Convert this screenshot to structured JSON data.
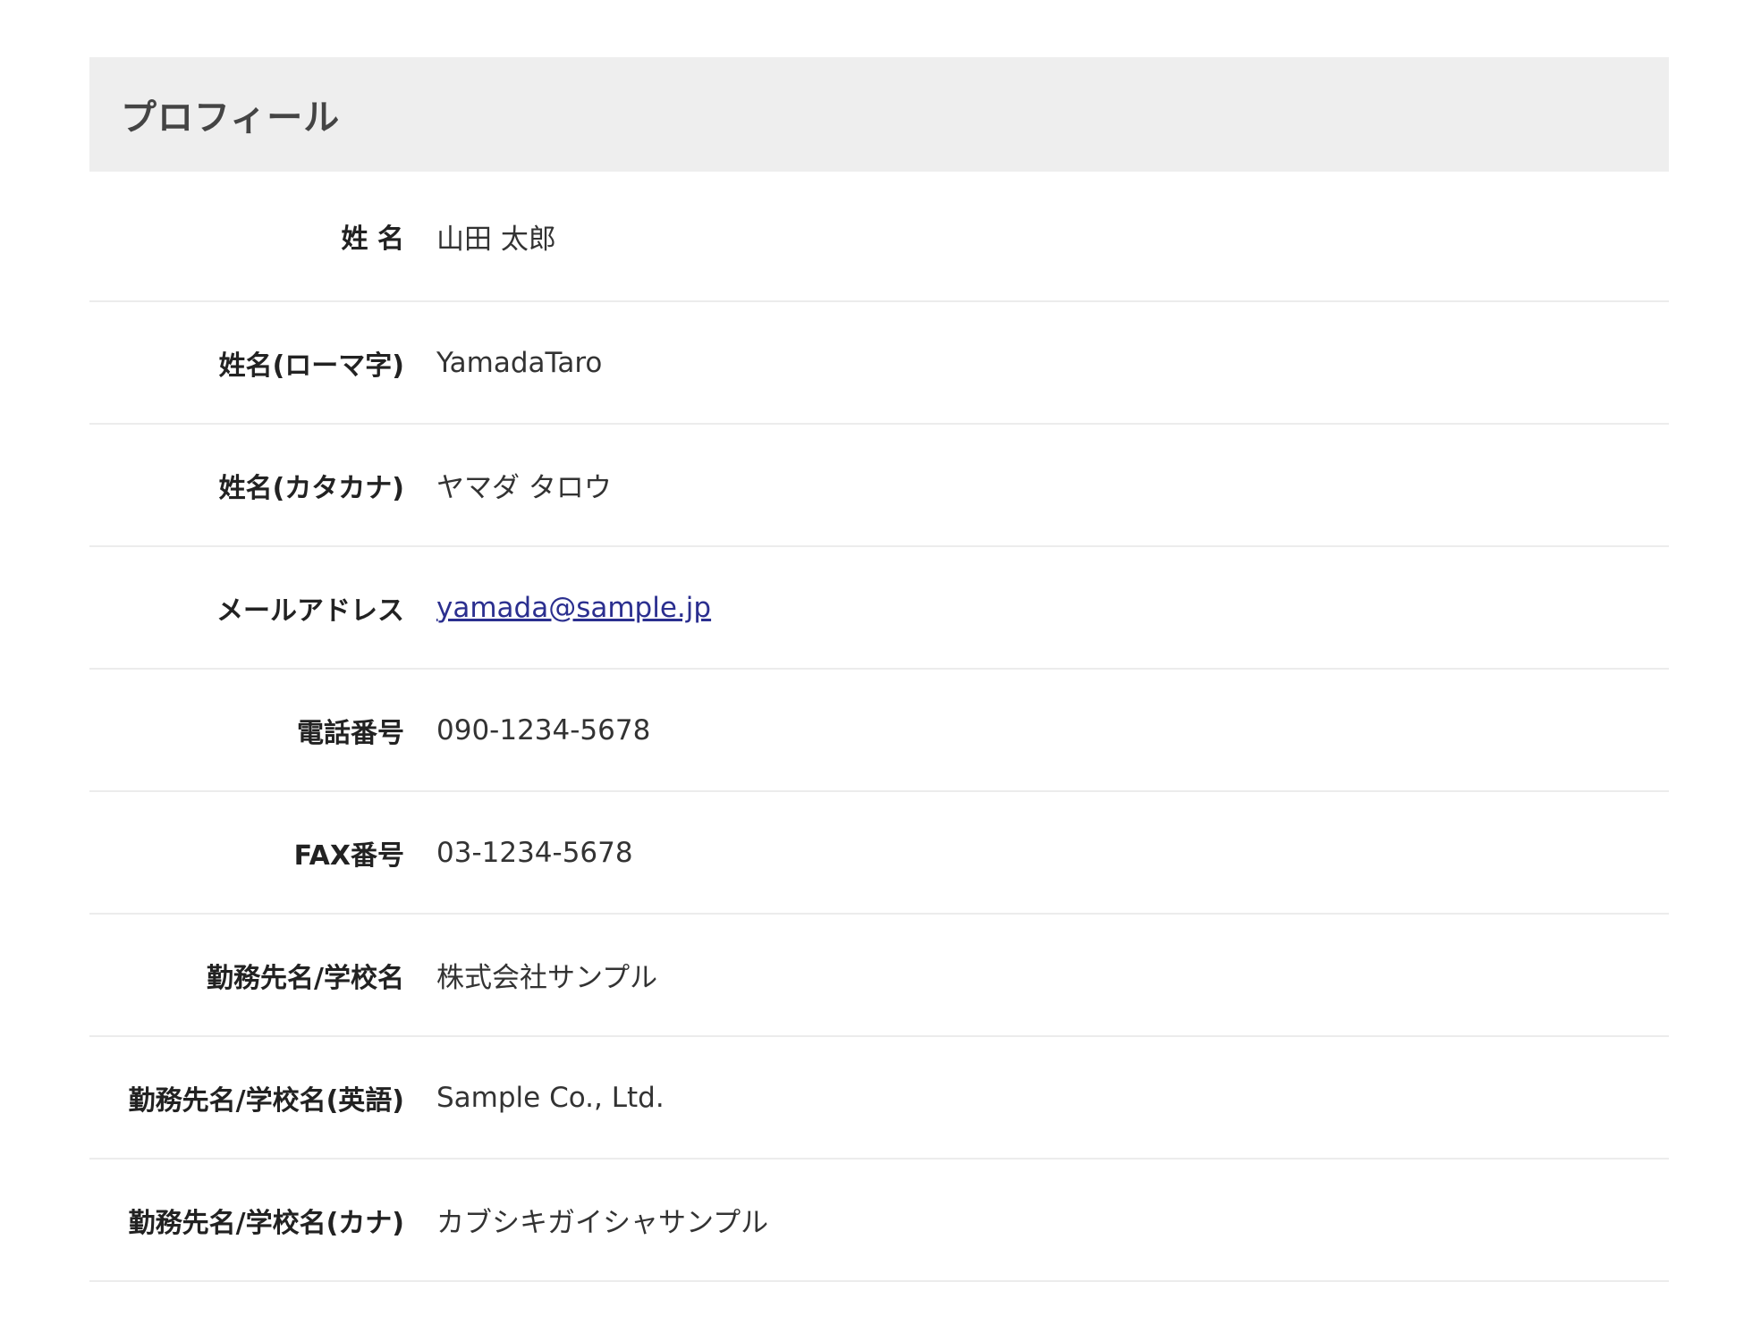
{
  "header": {
    "title": "プロフィール"
  },
  "rows": [
    {
      "label": "姓 名",
      "value": "山田 太郎"
    },
    {
      "label": "姓名(ローマ字)",
      "value": "YamadaTaro"
    },
    {
      "label": "姓名(カタカナ)",
      "value": "ヤマダ タロウ"
    },
    {
      "label": "メールアドレス",
      "value": "yamada@sample.jp"
    },
    {
      "label": "電話番号",
      "value": "090-1234-5678"
    },
    {
      "label": "FAX番号",
      "value": "03-1234-5678"
    },
    {
      "label": "勤務先名/学校名",
      "value": "株式会社サンプル"
    },
    {
      "label": "勤務先名/学校名(英語)",
      "value": "Sample Co., Ltd."
    },
    {
      "label": "勤務先名/学校名(カナ)",
      "value": "カブシキガイシャサンプル"
    }
  ],
  "colors": {
    "header_bg": "#eeeeee",
    "link": "#2b2f8f",
    "divider": "#ececec"
  }
}
